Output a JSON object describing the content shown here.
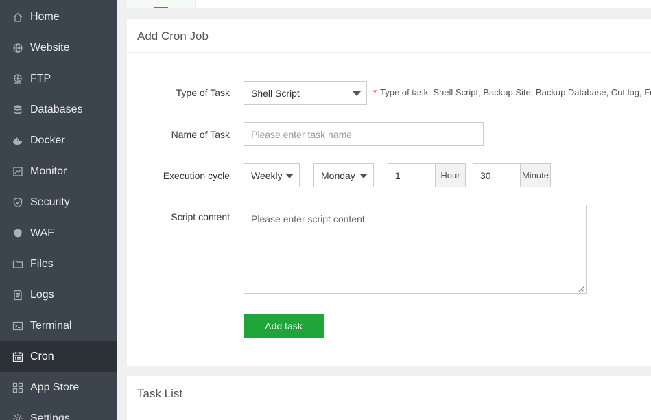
{
  "sidebar": {
    "items": [
      {
        "label": "Home",
        "icon": "home-icon",
        "active": false
      },
      {
        "label": "Website",
        "icon": "globe-icon",
        "active": false
      },
      {
        "label": "FTP",
        "icon": "ftp-globe-icon",
        "active": false
      },
      {
        "label": "Databases",
        "icon": "database-icon",
        "active": false
      },
      {
        "label": "Docker",
        "icon": "docker-icon",
        "active": false
      },
      {
        "label": "Monitor",
        "icon": "monitor-icon",
        "active": false
      },
      {
        "label": "Security",
        "icon": "shield-icon",
        "active": false
      },
      {
        "label": "WAF",
        "icon": "waf-shield-icon",
        "active": false
      },
      {
        "label": "Files",
        "icon": "folder-icon",
        "active": false
      },
      {
        "label": "Logs",
        "icon": "log-file-icon",
        "active": false
      },
      {
        "label": "Terminal",
        "icon": "terminal-icon",
        "active": false
      },
      {
        "label": "Cron",
        "icon": "calendar-icon",
        "active": true
      },
      {
        "label": "App Store",
        "icon": "apps-grid-icon",
        "active": false
      },
      {
        "label": "Settings",
        "icon": "gear-icon",
        "active": false
      }
    ]
  },
  "add_cron": {
    "title": "Add Cron Job",
    "type_label": "Type of Task",
    "type_value": "Shell Script",
    "type_hint": "Type of task: Shell Script, Backup Site, Backup Database, Cut log, Free",
    "name_label": "Name of Task",
    "name_placeholder": "Please enter task name",
    "cycle_label": "Execution cycle",
    "cycle_value": "Weekly",
    "day_value": "Monday",
    "hour_value": "1",
    "hour_unit": "Hour",
    "minute_value": "30",
    "minute_unit": "Minute",
    "script_label": "Script content",
    "script_placeholder": "Please enter script content",
    "submit_label": "Add task"
  },
  "task_list": {
    "title": "Task List"
  },
  "colors": {
    "accent": "#20a53a",
    "sidebar_bg": "#3c444d",
    "sidebar_active_bg": "#2b3137",
    "required_star": "#e33333"
  }
}
